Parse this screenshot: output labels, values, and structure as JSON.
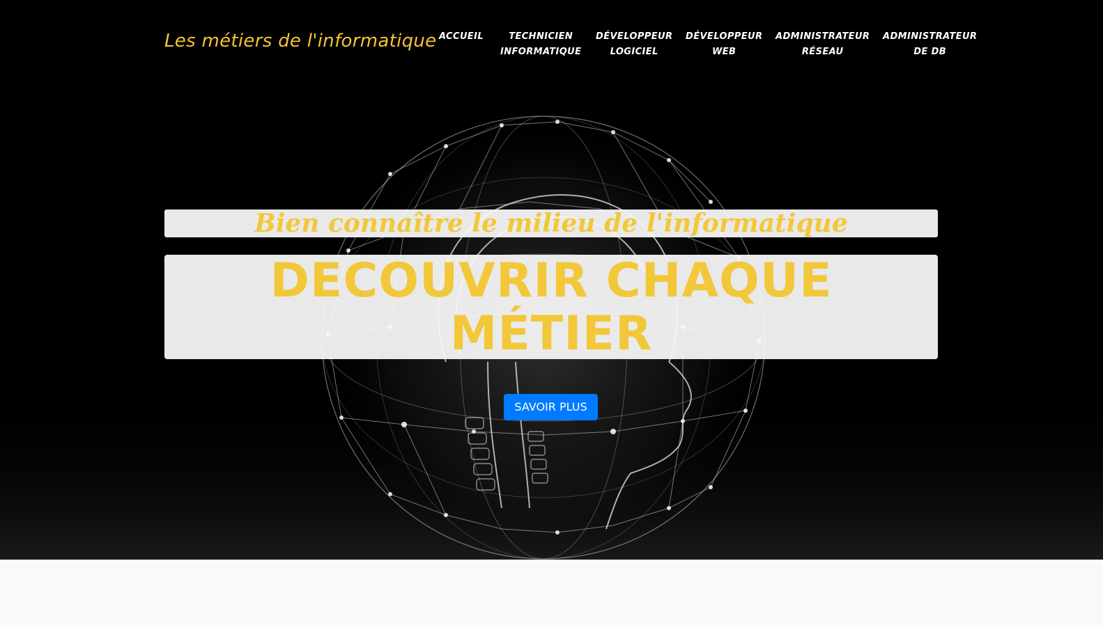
{
  "header": {
    "brand": "Les métiers de l'informatique",
    "nav": [
      {
        "line1": "ACCUEIL",
        "line2": ""
      },
      {
        "line1": "TECHNICIEN",
        "line2": "INFORMATIQUE"
      },
      {
        "line1": "DÉVELOPPEUR",
        "line2": "LOGICIEL"
      },
      {
        "line1": "DÉVELOPPEUR",
        "line2": "WEB"
      },
      {
        "line1": "ADMINISTRATEUR",
        "line2": "RÉSEAU"
      },
      {
        "line1": "ADMINISTRATEUR",
        "line2": "DE DB"
      }
    ]
  },
  "hero": {
    "subtitle": "Bien connaître le milieu de l'informatique",
    "title_line1": "DECOUVRIR CHAQUE",
    "title_line2": "MÉTIER",
    "cta_label": "SAVOIR PLUS",
    "background_icon": "brain-network-head-image"
  },
  "colors": {
    "accent": "#f2c83a",
    "button": "#007bff",
    "hero_bg": "#000000",
    "page_bg": "#f8f9fa"
  }
}
